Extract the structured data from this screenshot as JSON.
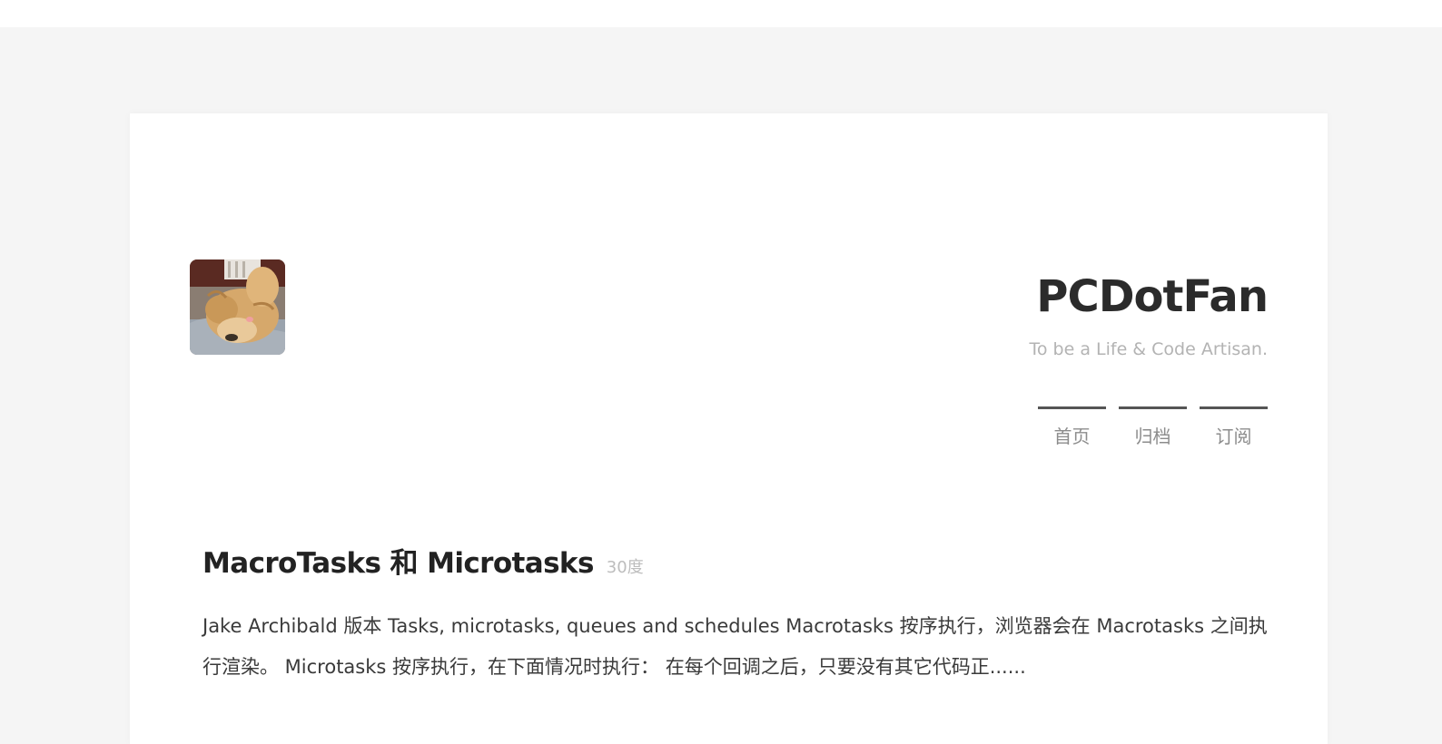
{
  "site": {
    "title": "PCDotFan",
    "subtitle": "To be a Life & Code Artisan."
  },
  "nav": {
    "items": [
      {
        "label": "首页"
      },
      {
        "label": "归档"
      },
      {
        "label": "订阅"
      }
    ]
  },
  "post": {
    "title": "MacroTasks 和 Microtasks",
    "meta": "30度",
    "excerpt": "Jake Archibald 版本 Tasks, microtasks, queues and schedules Macrotasks 按序执行，浏览器会在 Macrotasks 之间执行渲染。 Microtasks 按序执行，在下面情况时执行： 在每个回调之后，只要没有其它代码正......"
  },
  "icons": {
    "avatar": "cat-avatar"
  },
  "colors": {
    "page_background": "#f5f5f5",
    "card_background": "#ffffff",
    "nav_underline": "#555555"
  }
}
